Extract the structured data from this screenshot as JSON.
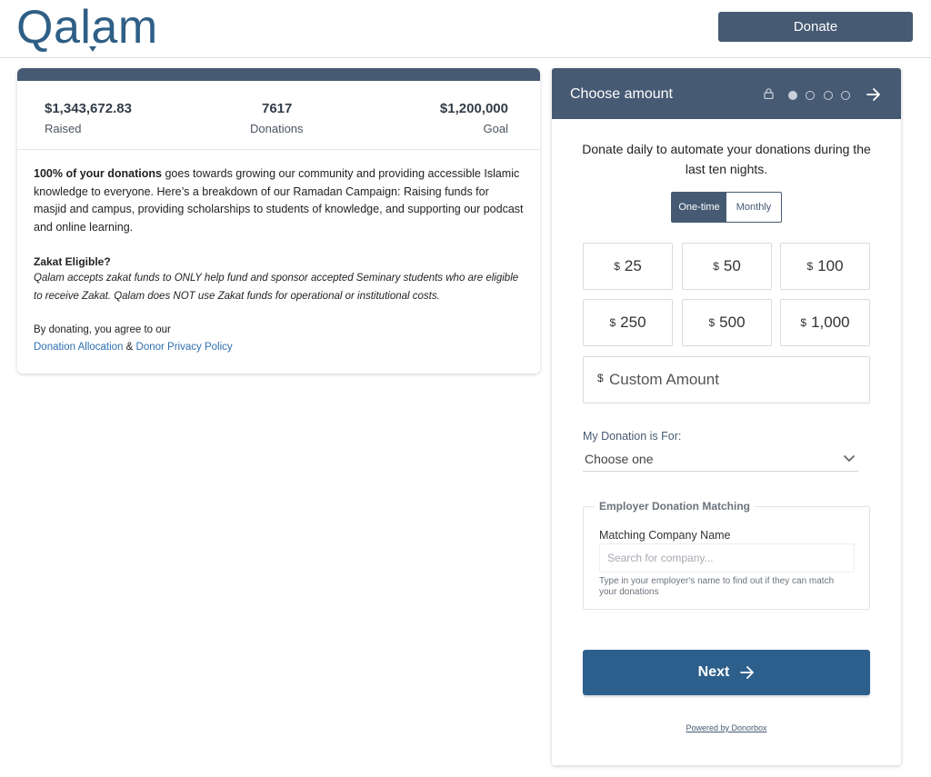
{
  "header": {
    "logo_text": "Qalam",
    "donate_label": "Donate"
  },
  "campaign": {
    "raised_value": "$1,343,672.83",
    "raised_label": "Raised",
    "donations_value": "7617",
    "donations_label": "Donations",
    "goal_value": "$1,200,000",
    "goal_label": "Goal",
    "progress_fraction": 1.0,
    "description_bold": "100% of your donations",
    "description_rest": " goes towards growing our community and providing accessible Islamic knowledge to everyone. Here’s a breakdown of our Ramadan Campaign: Raising funds for masjid and campus, providing scholarships to students of knowledge, and supporting our podcast and online learning.",
    "zakat_title": "Zakat Eligible?",
    "zakat_text": "Qalam accepts zakat funds to ONLY help fund and sponsor accepted Seminary students who are eligible to receive Zakat. Qalam does NOT use Zakat funds for operational or institutional costs.",
    "agree_text": "By donating, you agree to our",
    "link_allocation": "Donation Allocation",
    "link_sep": " & ",
    "link_privacy": "Donor Privacy Policy"
  },
  "donation_form": {
    "title": "Choose amount",
    "steps_total": 4,
    "step_current": 1,
    "intro": "Donate daily to automate your donations during the last ten nights.",
    "frequency": [
      "One-time",
      "Monthly"
    ],
    "frequency_selected": "One-time",
    "currency_symbol": "$",
    "amounts": [
      "25",
      "50",
      "100",
      "250",
      "500",
      "1,000"
    ],
    "custom_placeholder": "Custom Amount",
    "donation_for_label": "My Donation is For:",
    "donation_for_value": "Choose one",
    "employer_legend": "Employer Donation Matching",
    "employer_field_label": "Matching Company Name",
    "employer_placeholder": "Search for company...",
    "employer_help": "Type in your employer's name to find out if they can match your donations",
    "next_label": "Next",
    "powered_by": "Powered by Donorbox"
  },
  "colors": {
    "primary": "#465a73",
    "next_button": "#2d5f8c",
    "logo": "#2f5f86",
    "link": "#2f6fb0"
  }
}
